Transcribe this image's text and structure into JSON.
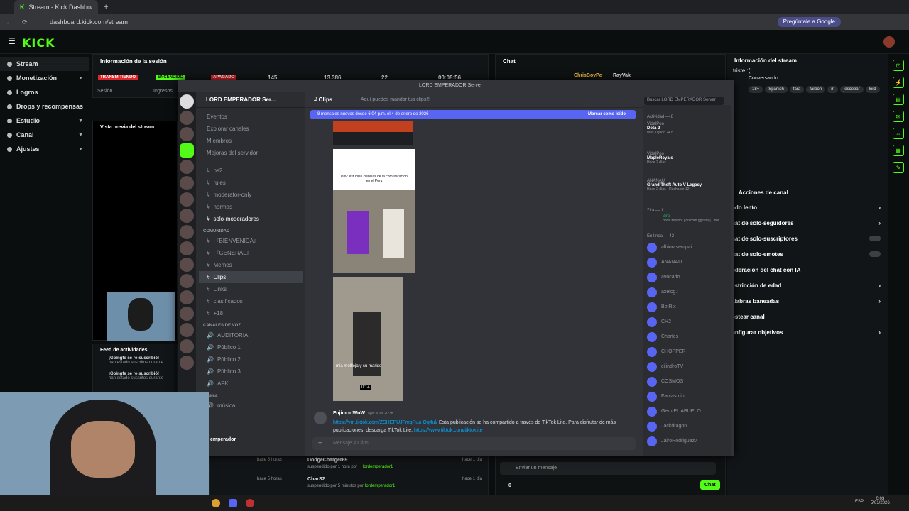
{
  "browser": {
    "tab_title": "Stream - Kick Dashboard",
    "url": "dashboard.kick.com/stream",
    "ask_google": "Pregúntale a Google"
  },
  "kick": {
    "logo": "KICK"
  },
  "sidebar": {
    "items": [
      {
        "label": "Stream"
      },
      {
        "label": "Monetización"
      },
      {
        "label": "Logros"
      },
      {
        "label": "Drops y recompensas"
      },
      {
        "label": "Estudio"
      },
      {
        "label": "Canal"
      },
      {
        "label": "Ajustes"
      }
    ]
  },
  "session": {
    "title": "Información de la sesión",
    "status_live": "TRANSMITIENDO",
    "status_on": "ENCENDIDO",
    "status_off": "APAGADO",
    "viewers": "145",
    "followers": "13.386",
    "subs": "22",
    "time": "00:08:56",
    "label_session": "Sesión",
    "label_income": "Ingresos"
  },
  "preview": {
    "title": "Vista previa del stream"
  },
  "feed": {
    "title": "Feed de actividades",
    "items": [
      {
        "name": "¡Goingfe se re-suscribió!",
        "sub": "han estado suscritos durante"
      },
      {
        "name": "¡Goingfe se re-suscribió!",
        "sub": "han estado suscritos durante"
      }
    ]
  },
  "mod_log": {
    "rows": [
      {
        "time": "hace 5 horas",
        "name": "DodgeCharger69",
        "action": "suspendido por 1 hora por",
        "by": "lordemperador1",
        "when": "hace 1 día"
      },
      {
        "time": "hace 5 horas",
        "name": "CharS2",
        "action": "suspendido por 5 minutos por",
        "by": "lordemperador1",
        "when": "hace 1 día"
      }
    ]
  },
  "chat": {
    "title": "Chat",
    "users": [
      "ChrisBoyPe",
      "RayVak"
    ],
    "placeholder": "Enviar un mensaje",
    "send": "Chat",
    "count": "0"
  },
  "stream_info": {
    "title": "Información del stream",
    "stream_title": "triste :(",
    "category": "Conversando",
    "tags": [
      "18+",
      "Spanish",
      "fara",
      "faraon",
      "irl",
      "jescobar",
      "lord"
    ]
  },
  "channel_actions": {
    "title": "Acciones de canal",
    "items": [
      "odo lento",
      "hat de solo-seguidores",
      "hat de solo-suscriptores",
      "hat de solo-emotes",
      "oderación del chat con IA",
      "estricción de edad",
      "alabras baneadas",
      "ostear canal",
      "onfigurar objetivos"
    ]
  },
  "discord": {
    "window_title": "LORD EMPERADOR Server",
    "server_name": "LORD EMPERADOR Ser...",
    "channel": "Clips",
    "topic": "Aquí puedes mandar tus clips!!!",
    "search": "Buscar LORD EMPERADOR Server",
    "banner": "8 mensajes nuevos desde 6:04 p.m. el 4 de enero de 2026",
    "mark_read": "Marcar como leído",
    "menu": [
      "Eventos",
      "Explorar canales",
      "Miembros",
      "Mejoras del servidor"
    ],
    "channels": [
      "ps2",
      "rules",
      "moderator-only",
      "normas",
      "solo-moderadores"
    ],
    "cat_comunidad": "COMUNIDAD",
    "community": [
      "『BIENVENIDA』",
      "『GENERAL』",
      "Memes",
      "Clips",
      "Links",
      "clasificados",
      "+18"
    ],
    "cat_voz": "CANALES DE VOZ",
    "voice": [
      "AUDITORIA",
      "Público 1",
      "Público 2",
      "Público 3",
      "AFK"
    ],
    "cat_musica": "Música",
    "music": "música",
    "user": "emperador",
    "video_caption": "Pov: estudias ciencias de la comunicación en el Peru",
    "video2_caption": "mia mollleja y su marido",
    "video_time": "0:14",
    "msg_author": "FujimoriWoW",
    "msg_time": "ayer a las 20:38",
    "msg_link": "https://vm.tiktok.com/ZSHEPUJFmqPua-Oq4ul/",
    "msg_text": "Esta publicación se ha compartido a través de TikTok Lite. Para disfrutar de más publicaciones, descarga TikTok Lite:",
    "msg_link2": "https://www.tiktok.com/tiktoklite",
    "compose": "Mensaje # Clips",
    "activity": "Actividad — 8",
    "games": [
      {
        "user": "VidalPoo",
        "game": "Dota 2",
        "sub": "Más jugado 24 h"
      },
      {
        "user": "VidalPoo",
        "game": "MapleRoyals",
        "sub": "Hace 2 días"
      },
      {
        "user": "ANANAU",
        "game": "Grand Theft Auto V Legacy",
        "sub": "Hace 2 días · Racha de 12"
      }
    ],
    "zira_hdr": "Zira — 1",
    "zira": "Zira",
    "zira_sub": "docs.zira.bot | discord.gg/zira | Cbot",
    "online_hdr": "En línea — 42",
    "members": [
      "albino sempai",
      "ANANAU",
      "avocado",
      "axelcg7",
      "BotRix",
      "CH2",
      "Charles",
      "CHOPPER",
      "cilindroTV",
      "COSMOS",
      "Fantasmin",
      "Gero EL ABUELO",
      "Jackdragon",
      "JairoRodriguez7"
    ]
  },
  "taskbar": {
    "time": "0:03",
    "date": "5/01/2026",
    "lang": "ESP"
  }
}
